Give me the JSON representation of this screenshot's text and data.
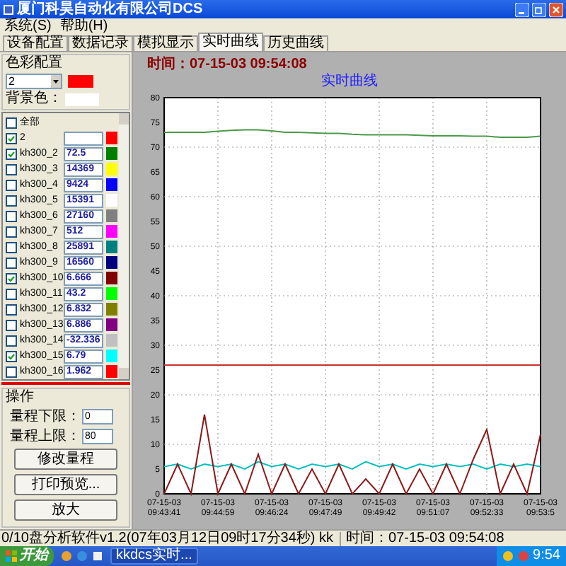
{
  "window": {
    "title": "厦门科昊自动化有限公司DCS"
  },
  "menu": [
    "系统(S)",
    "帮助(H)"
  ],
  "tabs": [
    {
      "label": "设备配置",
      "selected": false
    },
    {
      "label": "数据记录",
      "selected": false
    },
    {
      "label": "模拟显示",
      "selected": false
    },
    {
      "label": "实时曲线",
      "selected": true
    },
    {
      "label": "历史曲线",
      "selected": false
    }
  ],
  "color_config": {
    "title": "色彩配置",
    "channel": {
      "value": "2",
      "color": "#ff0000"
    },
    "background": {
      "label": "背景色：",
      "color": "#ffffff"
    }
  },
  "channels": [
    {
      "kind": "all",
      "name": "全部",
      "checked": false
    },
    {
      "kind": "channel",
      "name": "2",
      "checked": true,
      "color": "#ff0000"
    },
    {
      "kind": "channel",
      "name": "kh300_2",
      "checked": true,
      "value": "72.5",
      "color": "#008000"
    },
    {
      "kind": "channel",
      "name": "kh300_3",
      "checked": false,
      "value": "14369",
      "color": "#ffff00"
    },
    {
      "kind": "channel",
      "name": "kh300_4",
      "checked": false,
      "value": "9424",
      "color": "#0000ff"
    },
    {
      "kind": "channel",
      "name": "kh300_5",
      "checked": false,
      "value": "15391",
      "color": "#ffffff"
    },
    {
      "kind": "channel",
      "name": "kh300_6",
      "checked": false,
      "value": "27160",
      "color": "#808080"
    },
    {
      "kind": "channel",
      "name": "kh300_7",
      "checked": false,
      "value": "512",
      "color": "#ff00ff"
    },
    {
      "kind": "channel",
      "name": "kh300_8",
      "checked": false,
      "value": "25891",
      "color": "#008080"
    },
    {
      "kind": "channel",
      "name": "kh300_9",
      "checked": false,
      "value": "16560",
      "color": "#000080"
    },
    {
      "kind": "channel",
      "name": "kh300_10",
      "checked": true,
      "value": "6.666",
      "color": "#800000"
    },
    {
      "kind": "channel",
      "name": "kh300_11",
      "checked": false,
      "value": "43.2",
      "color": "#00ff00"
    },
    {
      "kind": "channel",
      "name": "kh300_12",
      "checked": false,
      "value": "6.832",
      "color": "#808000"
    },
    {
      "kind": "channel",
      "name": "kh300_13",
      "checked": false,
      "value": "6.886",
      "color": "#800080"
    },
    {
      "kind": "channel",
      "name": "kh300_14",
      "checked": false,
      "value": "-32.336",
      "color": "#c0c0c0"
    },
    {
      "kind": "channel",
      "name": "kh300_15",
      "checked": true,
      "value": "6.79",
      "color": "#00ffff"
    },
    {
      "kind": "channel",
      "name": "kh300_16",
      "checked": false,
      "value": "1.962",
      "color": "#ff0000"
    }
  ],
  "operation": {
    "title": "操作",
    "fields": [
      {
        "label": "量程下限：",
        "value": "0"
      },
      {
        "label": "量程上限：",
        "value": "80"
      }
    ],
    "buttons": [
      "修改量程",
      "打印预览...",
      "放大"
    ]
  },
  "chart": {
    "time_label": "时间：07-15-03 09:54:08",
    "chart_data": {
      "type": "line",
      "title": "实时曲线",
      "categories": [
        "07-15-03 09:43:41",
        null,
        null,
        null,
        "07-15-03 09:44:59",
        null,
        null,
        null,
        "07-15-03 09:46:24",
        null,
        null,
        null,
        "07-15-03 09:47:49",
        null,
        null,
        null,
        "07-15-03 09:49:42",
        null,
        null,
        null,
        "07-15-03 09:51:07",
        null,
        null,
        null,
        "07-15-03 09:52:33",
        null,
        null,
        null,
        "07-15-03 09:53:5"
      ],
      "series": [
        {
          "color": "#4a9a4a",
          "values": [
            73,
            73,
            73,
            73,
            73.2,
            73.4,
            73.5,
            73.5,
            73.3,
            73,
            73,
            72.9,
            72.8,
            72.8,
            72.6,
            72.5,
            72.5,
            72.5,
            72.5,
            72.4,
            72.3,
            72.3,
            72.3,
            72.2,
            72.2,
            72,
            72,
            72,
            72.2
          ]
        },
        {
          "color": "#c83030",
          "values": [
            26,
            26,
            26,
            26,
            26,
            26,
            26,
            26,
            26,
            26,
            26,
            26,
            26,
            26,
            26,
            26,
            26,
            26,
            26,
            26,
            26,
            26,
            26,
            26,
            26,
            26,
            26,
            26,
            26
          ]
        },
        {
          "color": "#00c0c0",
          "values": [
            5.5,
            6,
            5,
            6,
            5.5,
            6,
            5,
            6.5,
            5.5,
            6,
            5,
            6,
            5.5,
            6,
            5,
            6.5,
            5.5,
            6,
            5,
            6,
            5.5,
            6,
            5.5,
            6,
            5,
            6,
            5.5,
            6,
            5.5
          ]
        },
        {
          "color": "#8b1a1a",
          "values": [
            0,
            6,
            0,
            16,
            0,
            6,
            0,
            8,
            0,
            6,
            0,
            5,
            0,
            6,
            0,
            3,
            0,
            6,
            0,
            5,
            0,
            6,
            0,
            7,
            13,
            0,
            6,
            0,
            12
          ]
        }
      ],
      "ylim": [
        0,
        80
      ],
      "grid": true,
      "yticks": [
        0,
        5,
        10,
        15,
        20,
        25,
        30,
        35,
        40,
        45,
        50,
        55,
        60,
        65,
        70,
        75,
        80
      ]
    }
  },
  "status_bar": [
    "0/10盘分析软件v1.2(07年03月12日09时17分34秒) kk",
    "时间：07-15-03 09:54:08"
  ],
  "taskbar": {
    "start": "开始",
    "tasks": [
      "kkdcs实时..."
    ],
    "clock": "9:54"
  }
}
